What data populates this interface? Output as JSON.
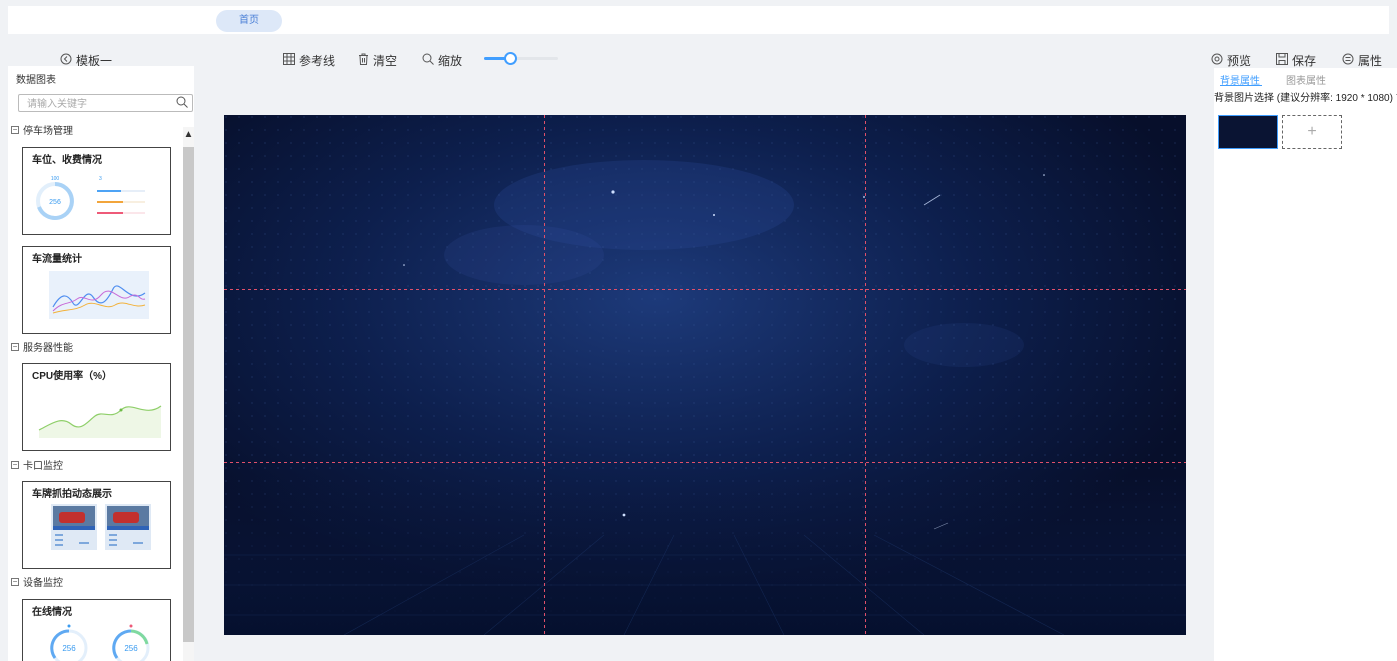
{
  "header": {
    "home_tab": "首页"
  },
  "toolbar": {
    "template": "模板一",
    "guides": "参考线",
    "clear": "清空",
    "zoom": "缩放",
    "zoom_value": 0.35,
    "preview": "预览",
    "save": "保存",
    "properties": "属性"
  },
  "left_panel": {
    "title": "数据图表",
    "search_placeholder": "请输入关键字",
    "categories": [
      {
        "label": "停车场管理",
        "cards": [
          "车位、收费情况",
          "车流量统计"
        ]
      },
      {
        "label": "服务器性能",
        "cards": [
          "CPU使用率（%）"
        ]
      },
      {
        "label": "卡口监控",
        "cards": [
          "车牌抓拍动态展示"
        ]
      },
      {
        "label": "设备监控",
        "cards": [
          "在线情况"
        ]
      }
    ],
    "card_texts": {
      "parking_gauge_value": "256",
      "parking_gauge_top": "100",
      "parking_small": "3",
      "online_left": "256",
      "online_right": "256"
    }
  },
  "right_panel": {
    "tabs": [
      "背景属性",
      "图表属性"
    ],
    "bg_label": "背景图片选择 (建议分辨率: 1920 * 1080)",
    "add_symbol": "+"
  },
  "colors": {
    "accent": "#409eff",
    "guide_line": "#e0506a",
    "canvas_bg": "#0b1a44"
  }
}
